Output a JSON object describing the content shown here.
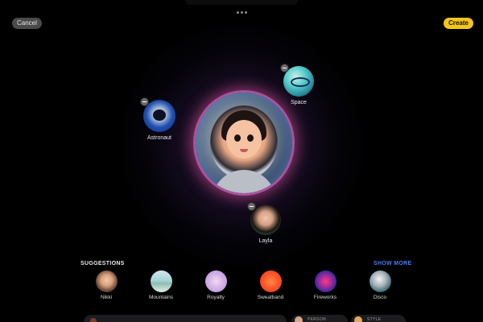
{
  "header": {
    "cancel_label": "Cancel",
    "create_label": "Create",
    "more_icon": "ellipsis-icon"
  },
  "canvas": {
    "chips": [
      {
        "label": "Astronaut",
        "kind": "astronaut"
      },
      {
        "label": "Space",
        "kind": "space"
      },
      {
        "label": "Layla",
        "kind": "person"
      }
    ]
  },
  "suggestions": {
    "title": "SUGGESTIONS",
    "show_more": "SHOW MORE",
    "items": [
      {
        "label": "Nikki"
      },
      {
        "label": "Mountains"
      },
      {
        "label": "Royalty"
      },
      {
        "label": "Sweatband"
      },
      {
        "label": "Fireworks"
      },
      {
        "label": "Disco"
      }
    ]
  },
  "footer": {
    "person_caption": "PERSON",
    "style_caption": "STYLE"
  },
  "colors": {
    "accent_yellow": "#f5c518",
    "link_blue": "#4b7bec",
    "background": "#000000"
  }
}
